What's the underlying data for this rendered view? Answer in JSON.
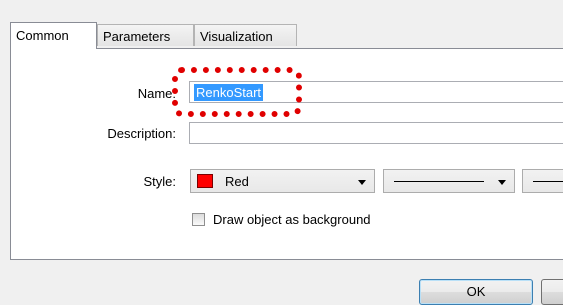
{
  "tabs": [
    {
      "label": "Common",
      "active": true
    },
    {
      "label": "Parameters",
      "active": false
    },
    {
      "label": "Visualization",
      "active": false
    }
  ],
  "form": {
    "name_label": "Name:",
    "name_value": "RenkoStart",
    "description_label": "Description:",
    "description_value": "",
    "style_label": "Style:",
    "color_value": "Red",
    "color_hex": "#ff0000",
    "checkbox_label": "Draw object as background",
    "checkbox_checked": false
  },
  "buttons": {
    "ok": "OK"
  },
  "highlight_color": "#e00000"
}
